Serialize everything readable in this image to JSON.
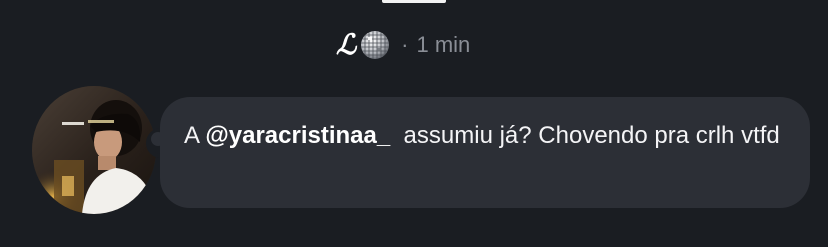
{
  "header": {
    "author_glyph": "ℒ",
    "author_icon": "disco-ball-icon",
    "separator": "·",
    "timestamp": "1 min"
  },
  "comment": {
    "avatar_icon": "user-photo-avatar",
    "prefix": "A ",
    "mention": "@yaracristinaa_",
    "body": "  assumiu já? Chovendo pra crlh vtfd"
  },
  "colors": {
    "background": "#1a1d22",
    "bubble": "#2c2f36",
    "text": "#f4f4f6",
    "muted": "#8a8e96"
  }
}
